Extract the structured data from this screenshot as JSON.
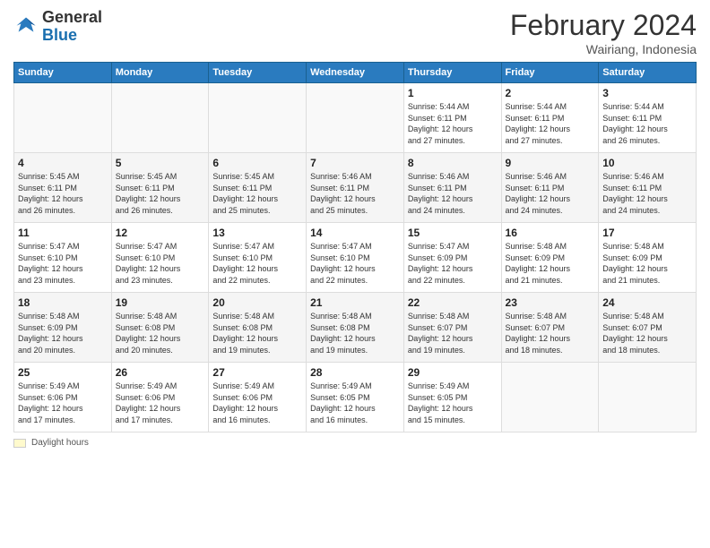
{
  "header": {
    "logo_general": "General",
    "logo_blue": "Blue",
    "main_title": "February 2024",
    "subtitle": "Wairiang, Indonesia"
  },
  "legend": {
    "box_label": "Daylight hours"
  },
  "columns": [
    "Sunday",
    "Monday",
    "Tuesday",
    "Wednesday",
    "Thursday",
    "Friday",
    "Saturday"
  ],
  "weeks": [
    [
      {
        "day": "",
        "info": ""
      },
      {
        "day": "",
        "info": ""
      },
      {
        "day": "",
        "info": ""
      },
      {
        "day": "",
        "info": ""
      },
      {
        "day": "1",
        "info": "Sunrise: 5:44 AM\nSunset: 6:11 PM\nDaylight: 12 hours\nand 27 minutes."
      },
      {
        "day": "2",
        "info": "Sunrise: 5:44 AM\nSunset: 6:11 PM\nDaylight: 12 hours\nand 27 minutes."
      },
      {
        "day": "3",
        "info": "Sunrise: 5:44 AM\nSunset: 6:11 PM\nDaylight: 12 hours\nand 26 minutes."
      }
    ],
    [
      {
        "day": "4",
        "info": "Sunrise: 5:45 AM\nSunset: 6:11 PM\nDaylight: 12 hours\nand 26 minutes."
      },
      {
        "day": "5",
        "info": "Sunrise: 5:45 AM\nSunset: 6:11 PM\nDaylight: 12 hours\nand 26 minutes."
      },
      {
        "day": "6",
        "info": "Sunrise: 5:45 AM\nSunset: 6:11 PM\nDaylight: 12 hours\nand 25 minutes."
      },
      {
        "day": "7",
        "info": "Sunrise: 5:46 AM\nSunset: 6:11 PM\nDaylight: 12 hours\nand 25 minutes."
      },
      {
        "day": "8",
        "info": "Sunrise: 5:46 AM\nSunset: 6:11 PM\nDaylight: 12 hours\nand 24 minutes."
      },
      {
        "day": "9",
        "info": "Sunrise: 5:46 AM\nSunset: 6:11 PM\nDaylight: 12 hours\nand 24 minutes."
      },
      {
        "day": "10",
        "info": "Sunrise: 5:46 AM\nSunset: 6:11 PM\nDaylight: 12 hours\nand 24 minutes."
      }
    ],
    [
      {
        "day": "11",
        "info": "Sunrise: 5:47 AM\nSunset: 6:10 PM\nDaylight: 12 hours\nand 23 minutes."
      },
      {
        "day": "12",
        "info": "Sunrise: 5:47 AM\nSunset: 6:10 PM\nDaylight: 12 hours\nand 23 minutes."
      },
      {
        "day": "13",
        "info": "Sunrise: 5:47 AM\nSunset: 6:10 PM\nDaylight: 12 hours\nand 22 minutes."
      },
      {
        "day": "14",
        "info": "Sunrise: 5:47 AM\nSunset: 6:10 PM\nDaylight: 12 hours\nand 22 minutes."
      },
      {
        "day": "15",
        "info": "Sunrise: 5:47 AM\nSunset: 6:09 PM\nDaylight: 12 hours\nand 22 minutes."
      },
      {
        "day": "16",
        "info": "Sunrise: 5:48 AM\nSunset: 6:09 PM\nDaylight: 12 hours\nand 21 minutes."
      },
      {
        "day": "17",
        "info": "Sunrise: 5:48 AM\nSunset: 6:09 PM\nDaylight: 12 hours\nand 21 minutes."
      }
    ],
    [
      {
        "day": "18",
        "info": "Sunrise: 5:48 AM\nSunset: 6:09 PM\nDaylight: 12 hours\nand 20 minutes."
      },
      {
        "day": "19",
        "info": "Sunrise: 5:48 AM\nSunset: 6:08 PM\nDaylight: 12 hours\nand 20 minutes."
      },
      {
        "day": "20",
        "info": "Sunrise: 5:48 AM\nSunset: 6:08 PM\nDaylight: 12 hours\nand 19 minutes."
      },
      {
        "day": "21",
        "info": "Sunrise: 5:48 AM\nSunset: 6:08 PM\nDaylight: 12 hours\nand 19 minutes."
      },
      {
        "day": "22",
        "info": "Sunrise: 5:48 AM\nSunset: 6:07 PM\nDaylight: 12 hours\nand 19 minutes."
      },
      {
        "day": "23",
        "info": "Sunrise: 5:48 AM\nSunset: 6:07 PM\nDaylight: 12 hours\nand 18 minutes."
      },
      {
        "day": "24",
        "info": "Sunrise: 5:48 AM\nSunset: 6:07 PM\nDaylight: 12 hours\nand 18 minutes."
      }
    ],
    [
      {
        "day": "25",
        "info": "Sunrise: 5:49 AM\nSunset: 6:06 PM\nDaylight: 12 hours\nand 17 minutes."
      },
      {
        "day": "26",
        "info": "Sunrise: 5:49 AM\nSunset: 6:06 PM\nDaylight: 12 hours\nand 17 minutes."
      },
      {
        "day": "27",
        "info": "Sunrise: 5:49 AM\nSunset: 6:06 PM\nDaylight: 12 hours\nand 16 minutes."
      },
      {
        "day": "28",
        "info": "Sunrise: 5:49 AM\nSunset: 6:05 PM\nDaylight: 12 hours\nand 16 minutes."
      },
      {
        "day": "29",
        "info": "Sunrise: 5:49 AM\nSunset: 6:05 PM\nDaylight: 12 hours\nand 15 minutes."
      },
      {
        "day": "",
        "info": ""
      },
      {
        "day": "",
        "info": ""
      }
    ]
  ]
}
